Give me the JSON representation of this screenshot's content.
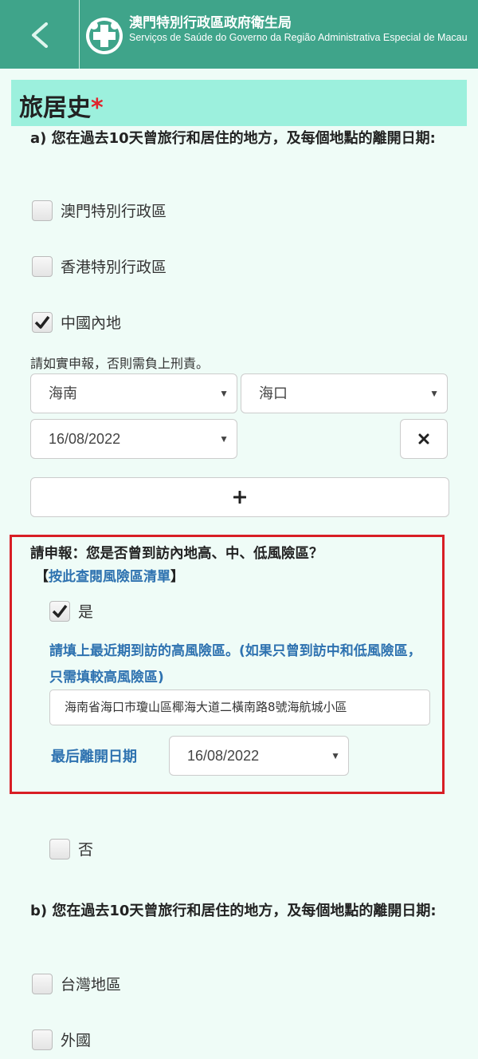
{
  "header": {
    "title": "澳門特別行政區政府衛生局",
    "subtitle": "Serviços de Saúde do Governo da Região Administrativa Especial de Macau"
  },
  "section": {
    "title": "旅居史",
    "required_mark": "*"
  },
  "part_a": {
    "question": "a) 您在過去10天曾旅行和居住的地方，及每個地點的離開日期:",
    "options": [
      {
        "label": "澳門特別行政區",
        "checked": false
      },
      {
        "label": "香港特別行政區",
        "checked": false
      },
      {
        "label": "中國內地",
        "checked": true
      }
    ],
    "notice": "請如實申報，否則需負上刑責。",
    "province": "海南",
    "city": "海口",
    "date": "16/08/2022",
    "remove_icon": "close-icon",
    "add_icon": "plus-icon"
  },
  "declare": {
    "question": "請申報：您是否曾到訪內地高、中、低風險區？",
    "link_prefix": "【",
    "link_text": "按此查閱風險區清單",
    "link_suffix": "】",
    "yes_label": "是",
    "yes_checked": true,
    "instruction": "請填上最近期到訪的高風險區。(如果只曾到訪中和低風險區，只需填較高風險區)",
    "address_value": "海南省海口市瓊山區椰海大道二橫南路8號海航城小區",
    "last_date_label": "最后離開日期",
    "last_date_value": "16/08/2022",
    "no_label": "否",
    "no_checked": false
  },
  "part_b": {
    "question": "b) 您在過去10天曾旅行和居住的地方，及每個地點的離開日期:",
    "options": [
      {
        "label": "台灣地區",
        "checked": false
      },
      {
        "label": "外國",
        "checked": false
      }
    ]
  },
  "colors": {
    "header_bg": "#3fa48a",
    "title_bar_bg": "#9cf0dd",
    "page_bg": "#effcf7",
    "link_blue": "#2e72b0",
    "highlight_red": "#d81e25"
  }
}
